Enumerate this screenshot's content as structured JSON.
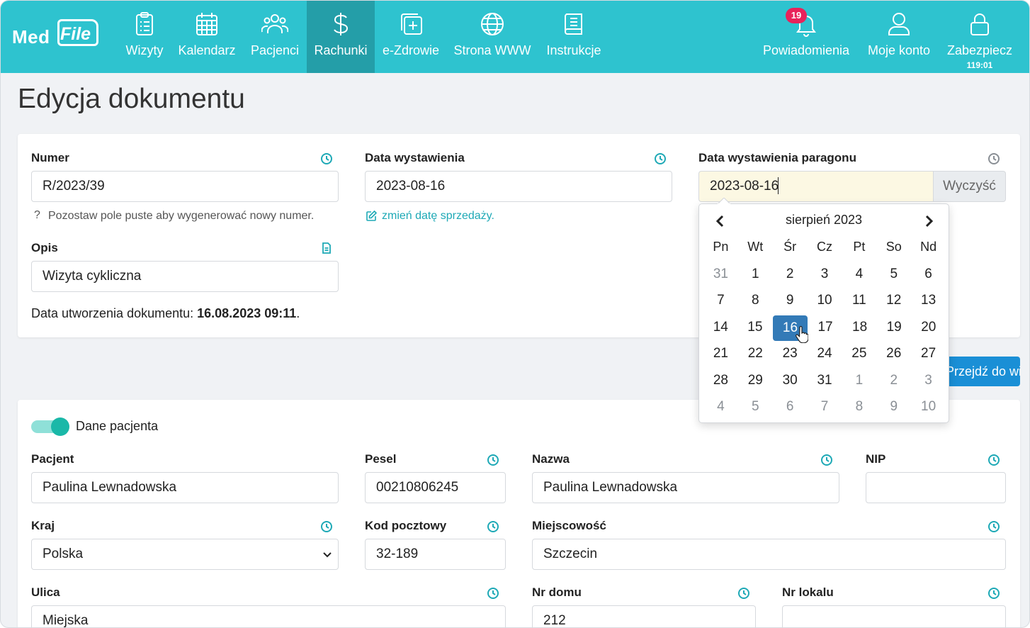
{
  "nav": {
    "logo_med": "Med",
    "logo_file": "File",
    "items": [
      {
        "label": "Wizyty"
      },
      {
        "label": "Kalendarz"
      },
      {
        "label": "Pacjenci"
      },
      {
        "label": "Rachunki"
      },
      {
        "label": "e-Zdrowie"
      },
      {
        "label": "Strona WWW"
      },
      {
        "label": "Instrukcje"
      }
    ],
    "notifications": {
      "label": "Powiadomienia",
      "count": "19"
    },
    "account": {
      "label": "Moje konto"
    },
    "lock": {
      "label": "Zabezpiecz",
      "timer": "119:01"
    }
  },
  "page_title": "Edycja dokumentu",
  "document": {
    "numer_label": "Numer",
    "numer_value": "R/2023/39",
    "numer_hint_mark": "?",
    "numer_hint": "Pozostaw pole puste aby wygenerować nowy numer.",
    "data_wyst_label": "Data wystawienia",
    "data_wyst_value": "2023-08-16",
    "zmien_link": "zmień datę sprzedaży.",
    "paragon_label": "Data wystawienia paragonu",
    "paragon_value": "2023-08-16",
    "clear_button": "Wyczyść",
    "opis_label": "Opis",
    "opis_value": "Wizyta cykliczna",
    "created_prefix": "Data utworzenia dokumentu: ",
    "created_value": "16.08.2023 09:11",
    "created_suffix": "."
  },
  "calendar": {
    "month": "sierpień 2023",
    "weekdays": [
      "Pn",
      "Wt",
      "Śr",
      "Cz",
      "Pt",
      "So",
      "Nd"
    ],
    "weeks": [
      [
        "31",
        "1",
        "2",
        "3",
        "4",
        "5",
        "6"
      ],
      [
        "7",
        "8",
        "9",
        "10",
        "11",
        "12",
        "13"
      ],
      [
        "14",
        "15",
        "16",
        "17",
        "18",
        "19",
        "20"
      ],
      [
        "21",
        "22",
        "23",
        "24",
        "25",
        "26",
        "27"
      ],
      [
        "28",
        "29",
        "30",
        "31",
        "1",
        "2",
        "3"
      ],
      [
        "4",
        "5",
        "6",
        "7",
        "8",
        "9",
        "10"
      ]
    ],
    "selected": "16"
  },
  "wizyta_button": "Przejdź do wizyty",
  "patient": {
    "toggle_label": "Dane pacjenta",
    "pacjent_label": "Pacjent",
    "pacjent_value": "Paulina Lewnadowska",
    "pesel_label": "Pesel",
    "pesel_value": "00210806245",
    "nazwa_label": "Nazwa",
    "nazwa_value": "Paulina Lewnadowska",
    "nip_label": "NIP",
    "nip_value": "",
    "kraj_label": "Kraj",
    "kraj_value": "Polska",
    "kod_label": "Kod pocztowy",
    "kod_value": "32-189",
    "miejscowosc_label": "Miejscowość",
    "miejscowosc_value": "Szczecin",
    "ulica_label": "Ulica",
    "ulica_value": "Miejska",
    "nr_domu_label": "Nr domu",
    "nr_domu_value": "212",
    "nr_lokalu_label": "Nr lokalu",
    "nr_lokalu_value": ""
  },
  "colors": {
    "nav_bg": "#2ec3cf",
    "nav_active": "#249ea8",
    "accent": "#1ea9b6",
    "selected_day": "#337ab7",
    "badge": "#e8235b",
    "primary_button": "#1a8fd6",
    "highlight_input": "#fcf8e3"
  }
}
